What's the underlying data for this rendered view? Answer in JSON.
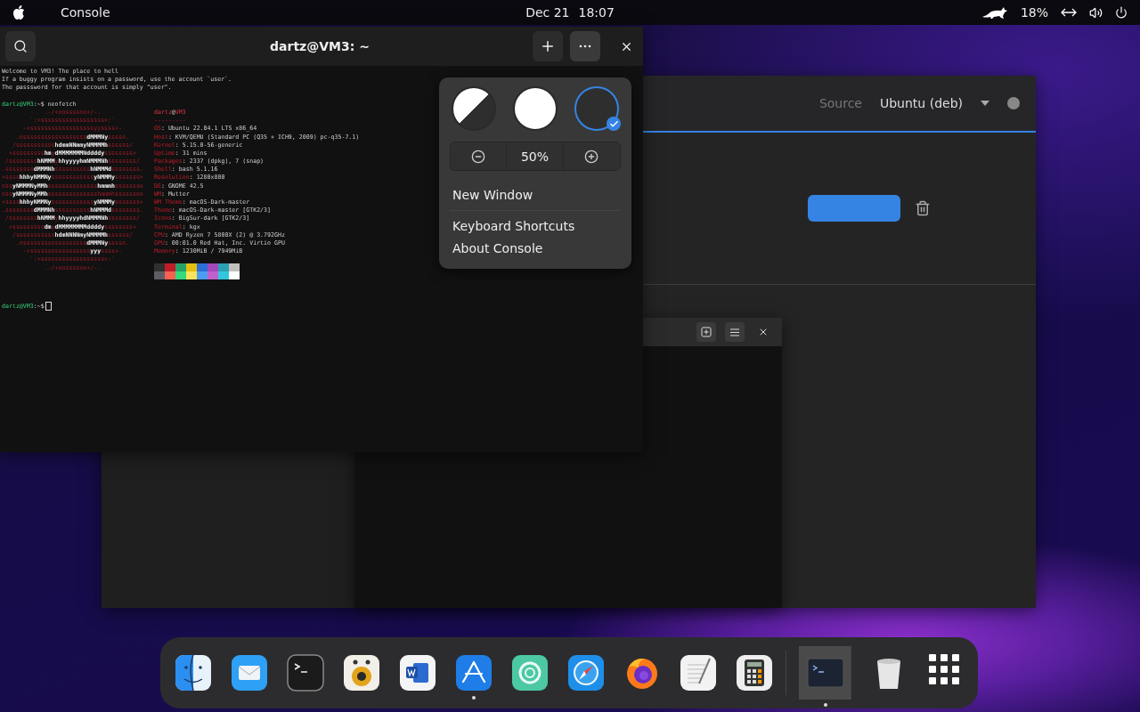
{
  "top_bar": {
    "app_name": "Console",
    "date": "Dec 21",
    "time": "18:07",
    "battery": "18%"
  },
  "terminal": {
    "title": "dartz@VM3: ~",
    "menu_open": true,
    "intro": [
      "Welcome to VM3! The place to hell",
      "If a buggy program insists on a password, use the account `user`.",
      "The passsword for that account is simply \"user\"."
    ],
    "prompt": "*dartz@VM3*:~$ neofetch",
    "logo": [
      "            .-/+oossssoo+/-.",
      "        `:+ssssssssssssssssss+:`",
      "      -+ssssssssssssssssssyyssss+-",
      "    .ossssssssssssssssss**dMMMNy**sssso.",
      "   /sssssssssss**hdmmNNmmyNMMMMh**ssssss/",
      "  +sssssssss**hm**y**dMMMMMMMNddddy**ssssssss+",
      " /ssssssss**hNMMM**y**hhyyyyhmNMMMNh**ssssssss/",
      ".ssssssss**dMMMNh**ssssssssss**hNMMMd**ssssssss.",
      "+ssss**hhhyNMMNy**ssssssssssss**yNMMMy**sssssss+",
      "oss**yNMMMNyMMh**ssssssssssssss**hmmmh**ssssssso",
      "oss**yNMMMNyMMh**sssssssssssssshmmmhssssssso",
      "+ssss**hhhyNMMNy**ssssssssssss**yNMMMy**sssssss+",
      ".ssssssss**dMMMNh**ssssssssss**hNMMMd**ssssssss.",
      " /ssssssss**hNMMM**y**hhyyyyhdNMMMNh**ssssssss/",
      "  +sssssssss**dm**y**dMMMMMMMMddddy**ssssssss+",
      "   /sssssssssss**hdmNNNNmyNMMMMh**ssssss/",
      "    .ossssssssssssssssss**dMMMNy**sssso.",
      "      -+sssssssssssssssss**yyy**ssss+-",
      "        `:+ssssssssssssssssss+:`",
      "            .-/+oossssoo+/-."
    ],
    "info_title": "*dartz*@*VM3*",
    "separator": "---------",
    "info": [
      "*OS*: Ubuntu 22.04.1 LTS x86_64",
      "*Host*: KVM/QEMU (Standard PC (Q35 + ICH9, 2009) pc-q35-7.1)",
      "*Kernel*: 5.15.0-56-generic",
      "*Uptime*: 31 mins",
      "*Packages*: 2337 (dpkg), 7 (snap)",
      "*Shell*: bash 5.1.16",
      "*Resolution*: 1280x800",
      "*DE*: GNOME 42.5",
      "*WM*: Mutter",
      "*WM Theme*: macOS-Dark-master",
      "*Theme*: macOS-Dark-master [GTK2/3]",
      "*Icons*: BigSur-dark [GTK2/3]",
      "*Terminal*: kgx",
      "*CPU*: AMD Ryzen 7 5800X (2) @ 3.792GHz",
      "*GPU*: 00:01.0 Red Hat, Inc. Virtio GPU",
      "*Memory*: 1230MiB / 7949MiB"
    ],
    "palette": [
      {
        "color": "#303030"
      },
      {
        "color": "#c01c28"
      },
      {
        "color": "#26a269"
      },
      {
        "color": "#e5c010"
      },
      {
        "color": "#2a6fd6"
      },
      {
        "color": "#a347ba"
      },
      {
        "color": "#2aa1b3"
      },
      {
        "color": "#c0bfbc"
      },
      {
        "color": "#5e5c64"
      },
      {
        "color": "#f66151"
      },
      {
        "color": "#33da7a"
      },
      {
        "color": "#f8e45c"
      },
      {
        "color": "#4a9ef0"
      },
      {
        "color": "#c061cb"
      },
      {
        "color": "#33c7de"
      },
      {
        "color": "#ffffff"
      }
    ],
    "final_prompt": "*dartz@VM3*:~$"
  },
  "menu": {
    "themes": [
      {
        "kind": "system",
        "selected": false
      },
      {
        "kind": "light",
        "selected": false
      },
      {
        "kind": "dark",
        "selected": true
      }
    ],
    "zoom": "50%",
    "items": [
      "New Window",
      "Keyboard Shortcuts",
      "About Console"
    ]
  },
  "software_window": {
    "source_label": "Source",
    "source_value": "Ubuntu (deb)"
  },
  "dock": [
    {
      "kind": "finder",
      "running": false,
      "selected": false
    },
    {
      "kind": "mail",
      "running": false,
      "selected": false
    },
    {
      "kind": "terminal",
      "running": false,
      "selected": false
    },
    {
      "kind": "speaker",
      "running": false,
      "selected": false
    },
    {
      "kind": "word",
      "running": false,
      "selected": false
    },
    {
      "kind": "appstore",
      "running": true,
      "selected": false
    },
    {
      "kind": "lifebuoy",
      "running": false,
      "selected": false
    },
    {
      "kind": "safari",
      "running": false,
      "selected": false
    },
    {
      "kind": "firefox",
      "running": false,
      "selected": false
    },
    {
      "kind": "textedit",
      "running": false,
      "selected": false
    },
    {
      "kind": "calculator",
      "running": false,
      "selected": false
    },
    {
      "kind": "console",
      "running": true,
      "selected": true
    },
    {
      "kind": "trash",
      "running": false,
      "selected": false
    },
    {
      "kind": "apps",
      "running": false,
      "selected": false
    }
  ]
}
